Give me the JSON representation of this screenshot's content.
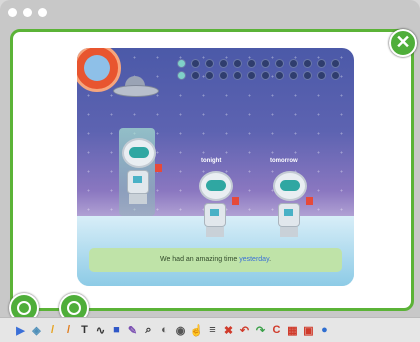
{
  "window": {
    "title": ""
  },
  "close_button": {
    "label": "✕"
  },
  "game": {
    "labels": {
      "tonight": "tonight",
      "tomorrow": "tomorrow"
    },
    "sentence": {
      "before": "We had an amazing time ",
      "highlight": "yesterday",
      "after": "."
    },
    "progress_dots": {
      "total": 24,
      "filled": 2
    }
  },
  "colors": {
    "accent": "#4fae3a",
    "sky": "#4b59a8",
    "sentence_bg": "#bfe3a8",
    "highlight": "#3a6fd8"
  },
  "toolbar": {
    "tools": [
      {
        "name": "arrow-tool-icon",
        "glyph": "▶",
        "color": "#3a6fd8"
      },
      {
        "name": "eraser-tool-icon",
        "glyph": "◈",
        "color": "#4e8fb9"
      },
      {
        "name": "pen-tool-icon",
        "glyph": "/",
        "color": "#e6a11a"
      },
      {
        "name": "highlighter-tool-icon",
        "glyph": "/",
        "color": "#e07a1a"
      },
      {
        "name": "text-tool-icon",
        "glyph": "T",
        "color": "#333"
      },
      {
        "name": "curve-tool-icon",
        "glyph": "∿",
        "color": "#333"
      },
      {
        "name": "shape-tool-icon",
        "glyph": "■",
        "color": "#2f57c7"
      },
      {
        "name": "stamp-tool-icon",
        "glyph": "✎",
        "color": "#7b4fb2"
      },
      {
        "name": "zoom-tool-icon",
        "glyph": "⌕",
        "color": "#333"
      },
      {
        "name": "spotlight-tool-icon",
        "glyph": "◐",
        "color": "#555"
      },
      {
        "name": "camera-tool-icon",
        "glyph": "◉",
        "color": "#555"
      },
      {
        "name": "hand-tool-icon",
        "glyph": "☝",
        "color": "#c49a31"
      },
      {
        "name": "menu-tool-icon",
        "glyph": "≡",
        "color": "#333"
      },
      {
        "name": "delete-tool-icon",
        "glyph": "✖",
        "color": "#d03a2a"
      },
      {
        "name": "undo-tool-icon",
        "glyph": "↶",
        "color": "#d03a2a"
      },
      {
        "name": "redo-tool-icon",
        "glyph": "↷",
        "color": "#3aa048"
      },
      {
        "name": "capture-tool-icon",
        "glyph": "C",
        "color": "#d03a2a"
      },
      {
        "name": "gallery-tool-icon",
        "glyph": "▦",
        "color": "#d03a2a"
      },
      {
        "name": "save-tool-icon",
        "glyph": "▣",
        "color": "#d03a2a"
      },
      {
        "name": "help-tool-icon",
        "glyph": "●",
        "color": "#2f6ed0"
      }
    ]
  }
}
